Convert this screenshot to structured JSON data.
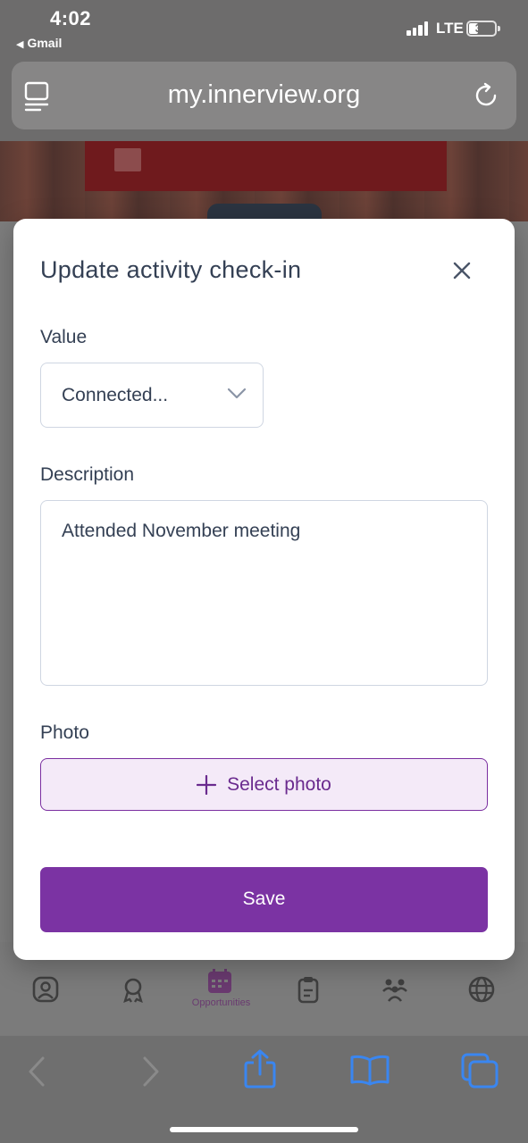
{
  "status_bar": {
    "time": "4:02",
    "back_app": "Gmail",
    "network": "LTE",
    "battery": "37",
    "battery_level": 0.37
  },
  "browser": {
    "url": "my.innerview.org"
  },
  "background_page": {
    "active_tab_label": "Opportunities"
  },
  "modal": {
    "title": "Update activity check-in",
    "value_label": "Value",
    "value_selected": "Connected...",
    "description_label": "Description",
    "description_value": "Attended November meeting",
    "photo_label": "Photo",
    "select_photo_label": "Select photo",
    "save_label": "Save"
  },
  "colors": {
    "accent": "#7b33a3",
    "photo_button_bg": "#f4eaf8",
    "text": "#344054",
    "ios_blue": "#3a86f0"
  },
  "icons": {
    "reader": "reader-mode-icon",
    "reload": "reload-icon",
    "close": "close-icon",
    "chevron": "chevron-down-icon",
    "plus": "plus-icon",
    "back": "back-arrow-icon",
    "forward": "forward-arrow-icon",
    "share": "share-icon",
    "bookmarks": "bookmarks-icon",
    "tabs": "tabs-icon"
  }
}
